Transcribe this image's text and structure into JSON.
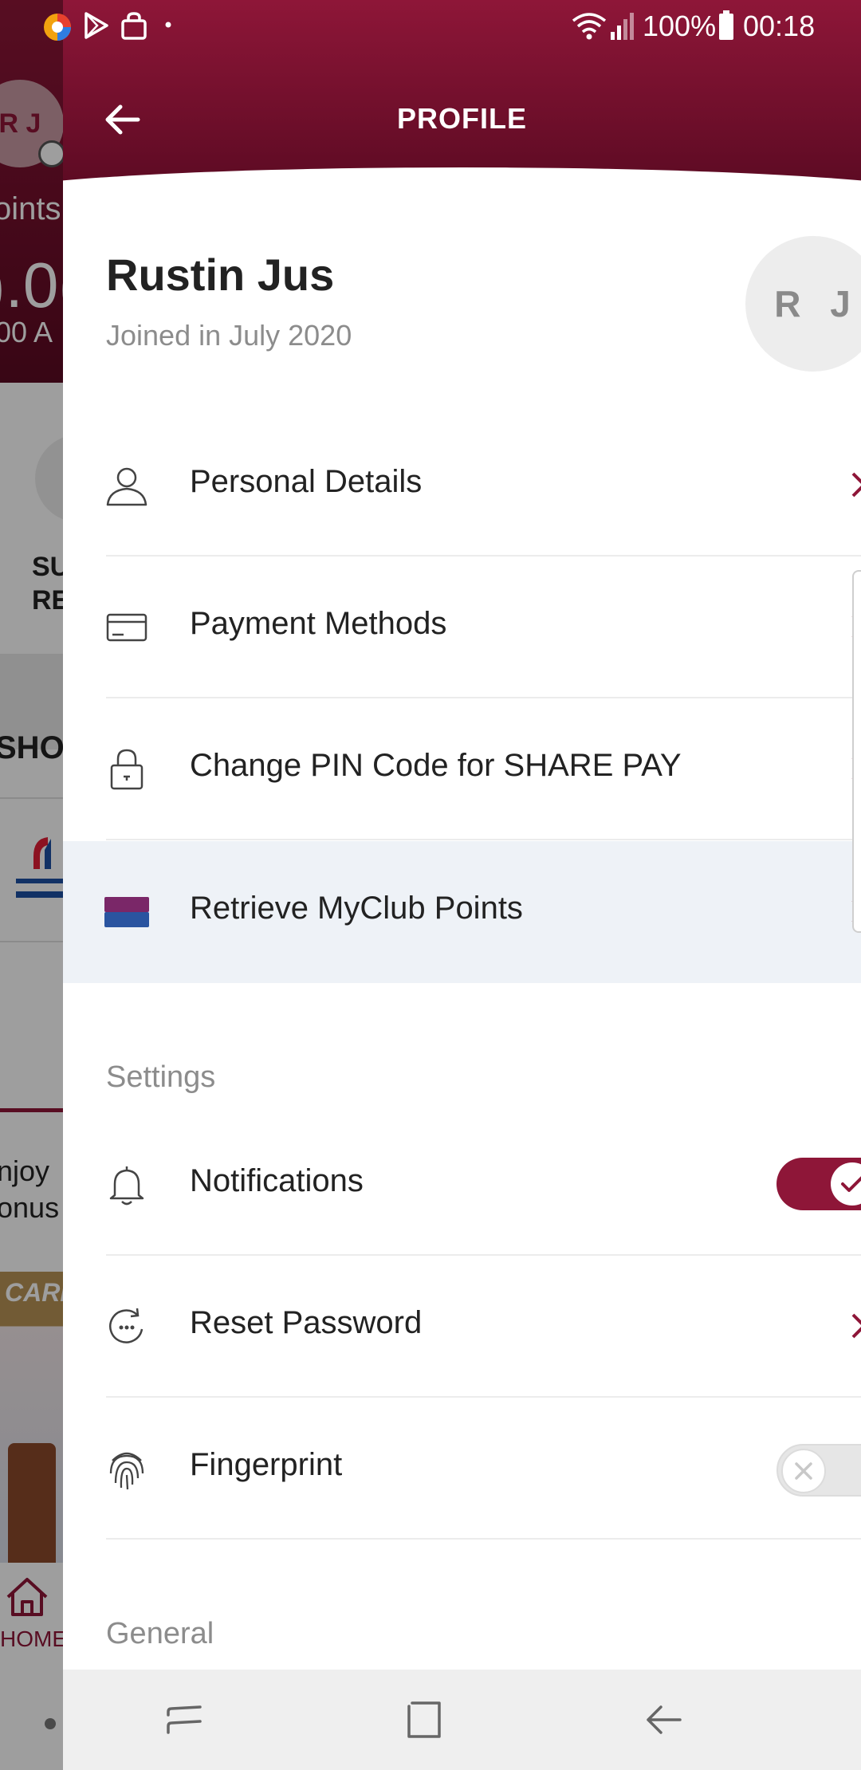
{
  "status_bar": {
    "battery": "100%",
    "time": "00:18"
  },
  "background": {
    "avatar_initials": "R J",
    "points_fragment": "oints",
    "big_value_fragment": ").0(",
    "sub_fragment": "00 A",
    "su_fragment": "SU\nRE",
    "shop_fragment": "SHOP",
    "enjoy_fragment": "njoy\nonus",
    "carr_fragment": "CARR",
    "home_label": "HOME"
  },
  "header": {
    "title": "PROFILE"
  },
  "profile": {
    "name": "Rustin Jus",
    "joined": "Joined in July 2020",
    "avatar_initials": "R J"
  },
  "menu": {
    "items": [
      {
        "label": "Personal Details",
        "icon": "person-icon"
      },
      {
        "label": "Payment Methods",
        "icon": "credit-card-icon"
      },
      {
        "label": "Change PIN Code for SHARE PAY",
        "icon": "lock-icon"
      },
      {
        "label": "Retrieve MyClub Points",
        "icon": "myclub-card-icon"
      }
    ]
  },
  "settings": {
    "heading": "Settings",
    "items": [
      {
        "label": "Notifications",
        "icon": "bell-icon",
        "toggle": true
      },
      {
        "label": "Reset Password",
        "icon": "reset-password-icon"
      },
      {
        "label": "Fingerprint",
        "icon": "fingerprint-icon",
        "toggle": false
      }
    ]
  },
  "general": {
    "heading": "General"
  },
  "colors": {
    "brand": "#8e1638",
    "brand_dark": "#5a0a22",
    "highlight_row": "#eef2f7",
    "myclub_top": "#7a2768",
    "myclub_bottom": "#2a54a0"
  }
}
